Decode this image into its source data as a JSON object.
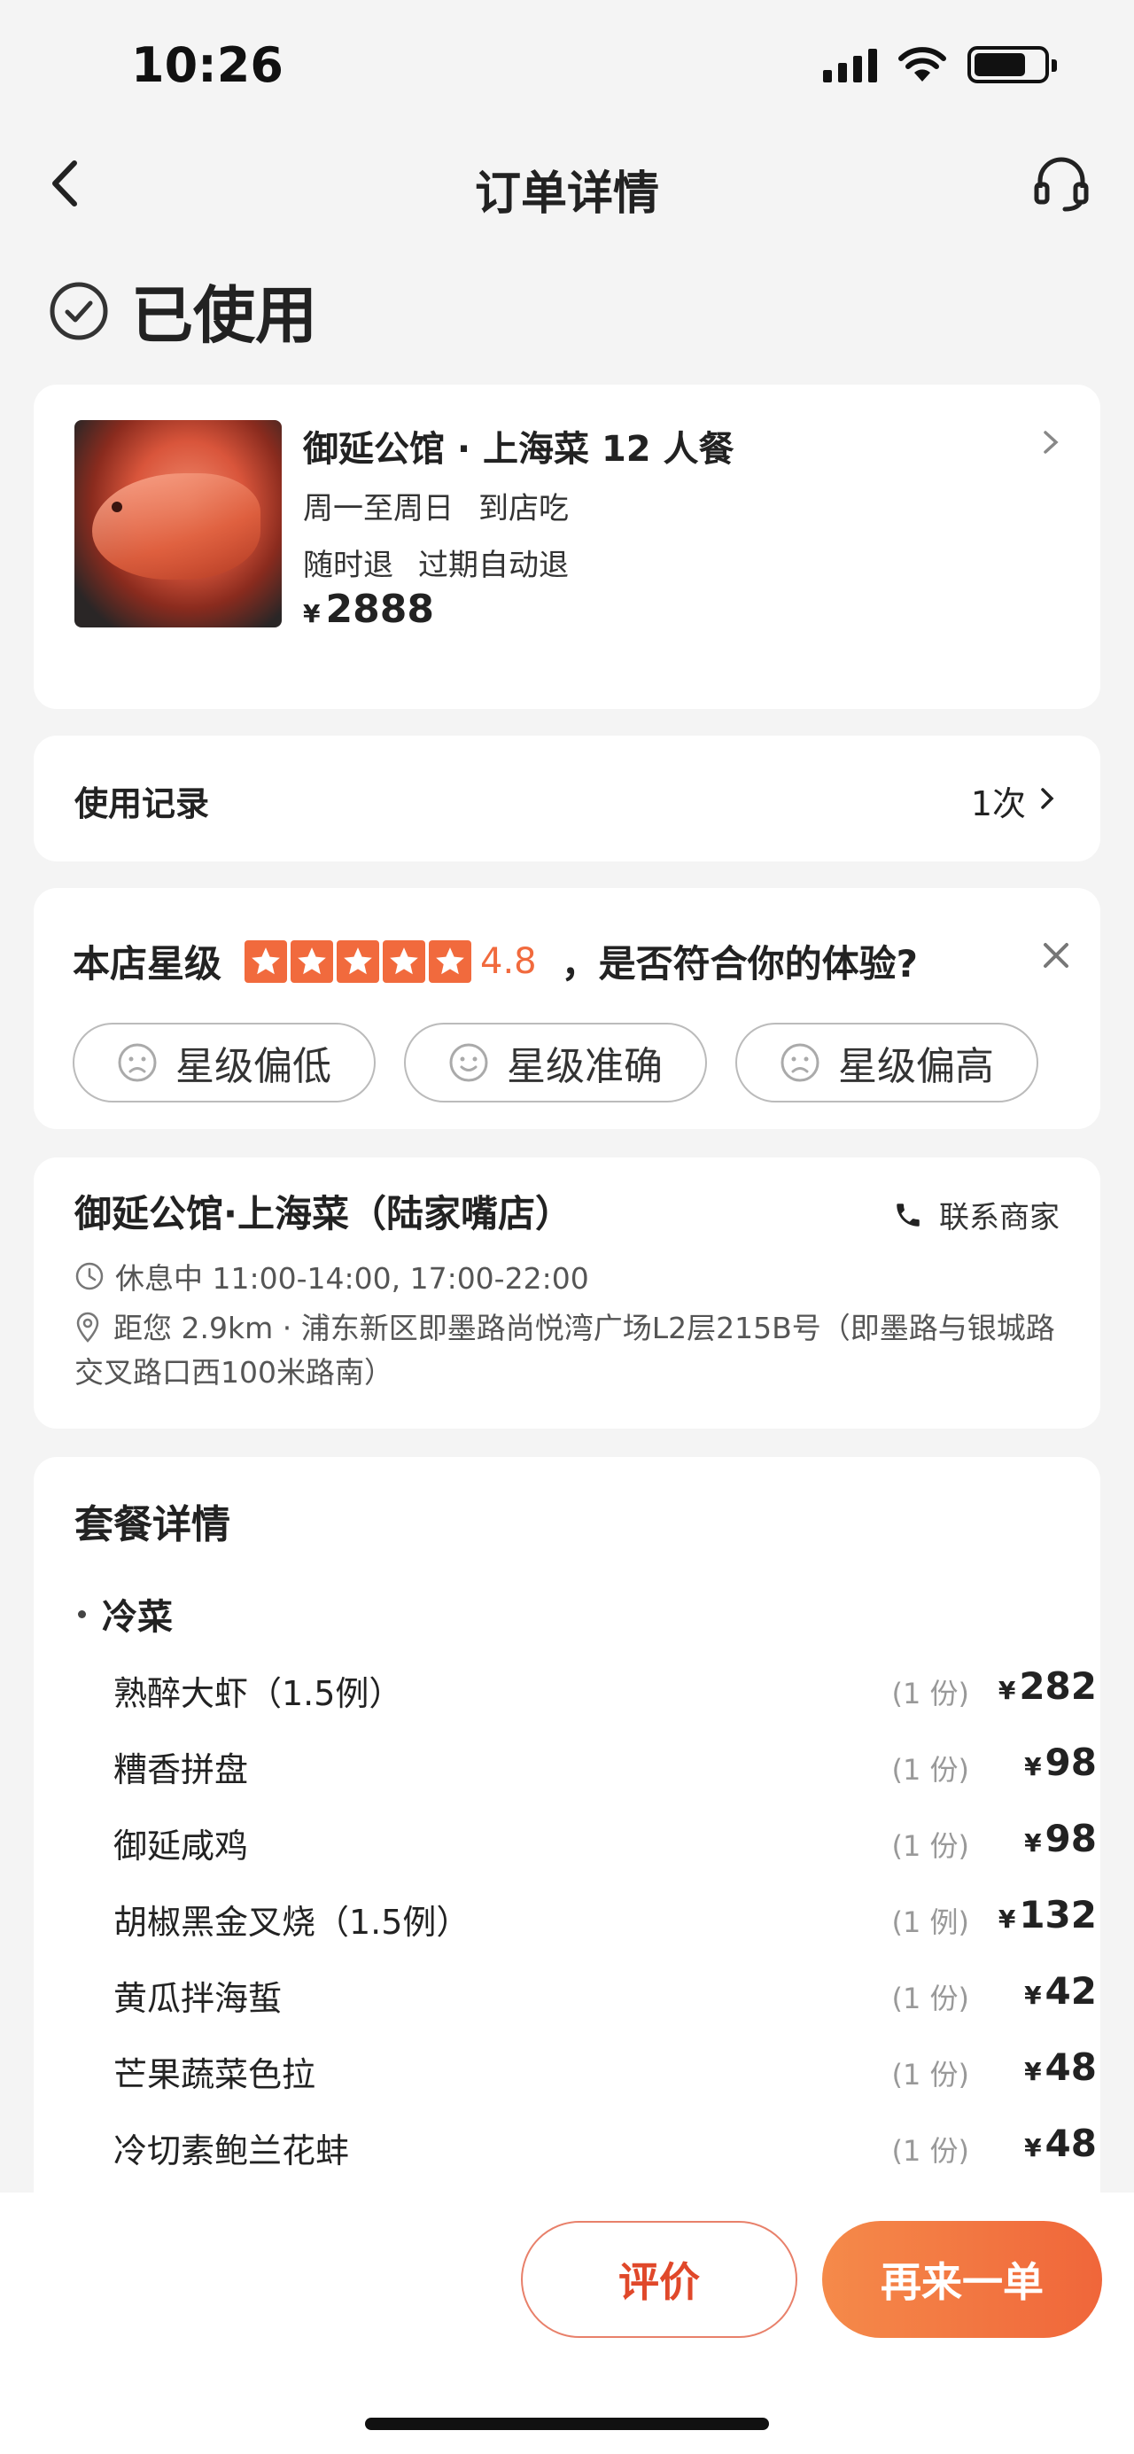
{
  "status_bar": {
    "time": "10:26"
  },
  "nav": {
    "title": "订单详情"
  },
  "order": {
    "status": "已使用"
  },
  "product": {
    "title": "御延公馆 · 上海菜 12 人餐",
    "days": "周一至周日",
    "mode": "到店吃",
    "refund1": "随时退",
    "refund2": "过期自动退",
    "currency": "¥",
    "price": "2888"
  },
  "usage": {
    "label": "使用记录",
    "count": "1次"
  },
  "rating": {
    "label": "本店星级",
    "stars": 5,
    "value": "4.8",
    "question": "，是否符合你的体验?",
    "options": [
      "星级偏低",
      "星级准确",
      "星级偏高"
    ]
  },
  "shop": {
    "name": "御延公馆·上海菜（陆家嘴店）",
    "contact": "联系商家",
    "hours": "休息中 11:00-14:00, 17:00-22:00",
    "address": "距您 2.9km · 浦东新区即墨路尚悦湾广场L2层215B号（即墨路与银城路交叉路口西100米路南）"
  },
  "package": {
    "title": "套餐详情",
    "section": "冷菜",
    "items": [
      {
        "name": "熟醉大虾（1.5例）",
        "qty": "(1 份)",
        "currency": "¥",
        "price": "282"
      },
      {
        "name": "糟香拼盘",
        "qty": "(1 份)",
        "currency": "¥",
        "price": "98"
      },
      {
        "name": "御延咸鸡",
        "qty": "(1 份)",
        "currency": "¥",
        "price": "98"
      },
      {
        "name": "胡椒黑金叉烧（1.5例）",
        "qty": "(1 例)",
        "currency": "¥",
        "price": "132"
      },
      {
        "name": "黄瓜拌海蜇",
        "qty": "(1 份)",
        "currency": "¥",
        "price": "42"
      },
      {
        "name": "芒果蔬菜色拉",
        "qty": "(1 份)",
        "currency": "¥",
        "price": "48"
      },
      {
        "name": "冷切素鲍兰花蚌",
        "qty": "(1 份)",
        "currency": "¥",
        "price": "48"
      }
    ]
  },
  "actions": {
    "review": "评价",
    "reorder": "再来一单"
  },
  "colors": {
    "accent": "#f16a3d",
    "button_gradient_start": "#f58a4a",
    "button_gradient_end": "#f0663a"
  }
}
